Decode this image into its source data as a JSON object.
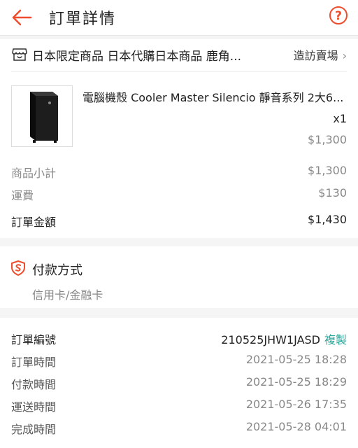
{
  "header": {
    "title": "訂單詳情",
    "accent": "#ee4d2d"
  },
  "shop": {
    "name": "日本限定商品 日本代購日本商品 鹿角...",
    "visit_label": "造訪賣場"
  },
  "product": {
    "name": "電腦機殼 Cooler Master Silencio 靜音系列 2大6...",
    "qty": "x1",
    "price": "$1,300"
  },
  "summary": {
    "subtotal_label": "商品小計",
    "subtotal": "$1,300",
    "shipping_label": "運費",
    "shipping": "$130",
    "total_label": "訂單金額",
    "total": "$1,430"
  },
  "payment": {
    "title": "付款方式",
    "method": "信用卡/金融卡"
  },
  "order_info": {
    "number_label": "訂單編號",
    "number": "210525JHW1JASD",
    "copy_label": "複製",
    "rows": [
      {
        "label": "訂單時間",
        "value": "2021-05-25 18:28"
      },
      {
        "label": "付款時間",
        "value": "2021-05-25 18:29"
      },
      {
        "label": "運送時間",
        "value": "2021-05-26 17:35"
      },
      {
        "label": "完成時間",
        "value": "2021-05-28 04:01"
      }
    ]
  }
}
